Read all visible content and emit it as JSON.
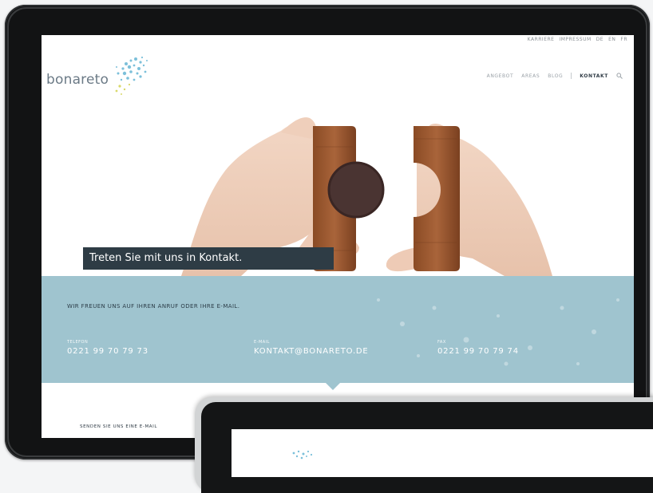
{
  "header": {
    "topbar": [
      "KARRIERE",
      "IMPRESSUM",
      "DE",
      "EN",
      "FR"
    ],
    "logo_text": "bonareto",
    "nav": [
      {
        "label": "ANGEBOT",
        "active": false
      },
      {
        "label": "AREAS",
        "active": false
      },
      {
        "label": "BLOG",
        "active": false
      },
      {
        "label": "KONTAKT",
        "active": true
      }
    ]
  },
  "hero": {
    "caption": "Treten Sie mit uns in Kontakt."
  },
  "contact": {
    "intro": "WIR FREUEN UNS AUF IHREN ANRUF ODER IHRE E-MAIL.",
    "telefon": {
      "label": "TELEFON",
      "value": "0221 99 70 79 73"
    },
    "email": {
      "label": "E-MAIL",
      "value": "KONTAKT@BONARETO.DE"
    },
    "fax": {
      "label": "FAX",
      "value": "0221 99 70 79 74"
    }
  },
  "form": {
    "title": "SENDEN SIE UNS EINE E-MAIL"
  },
  "colors": {
    "band": "#9fc4cf",
    "caption_bg": "#2e3c45",
    "bezel": "#121314"
  }
}
